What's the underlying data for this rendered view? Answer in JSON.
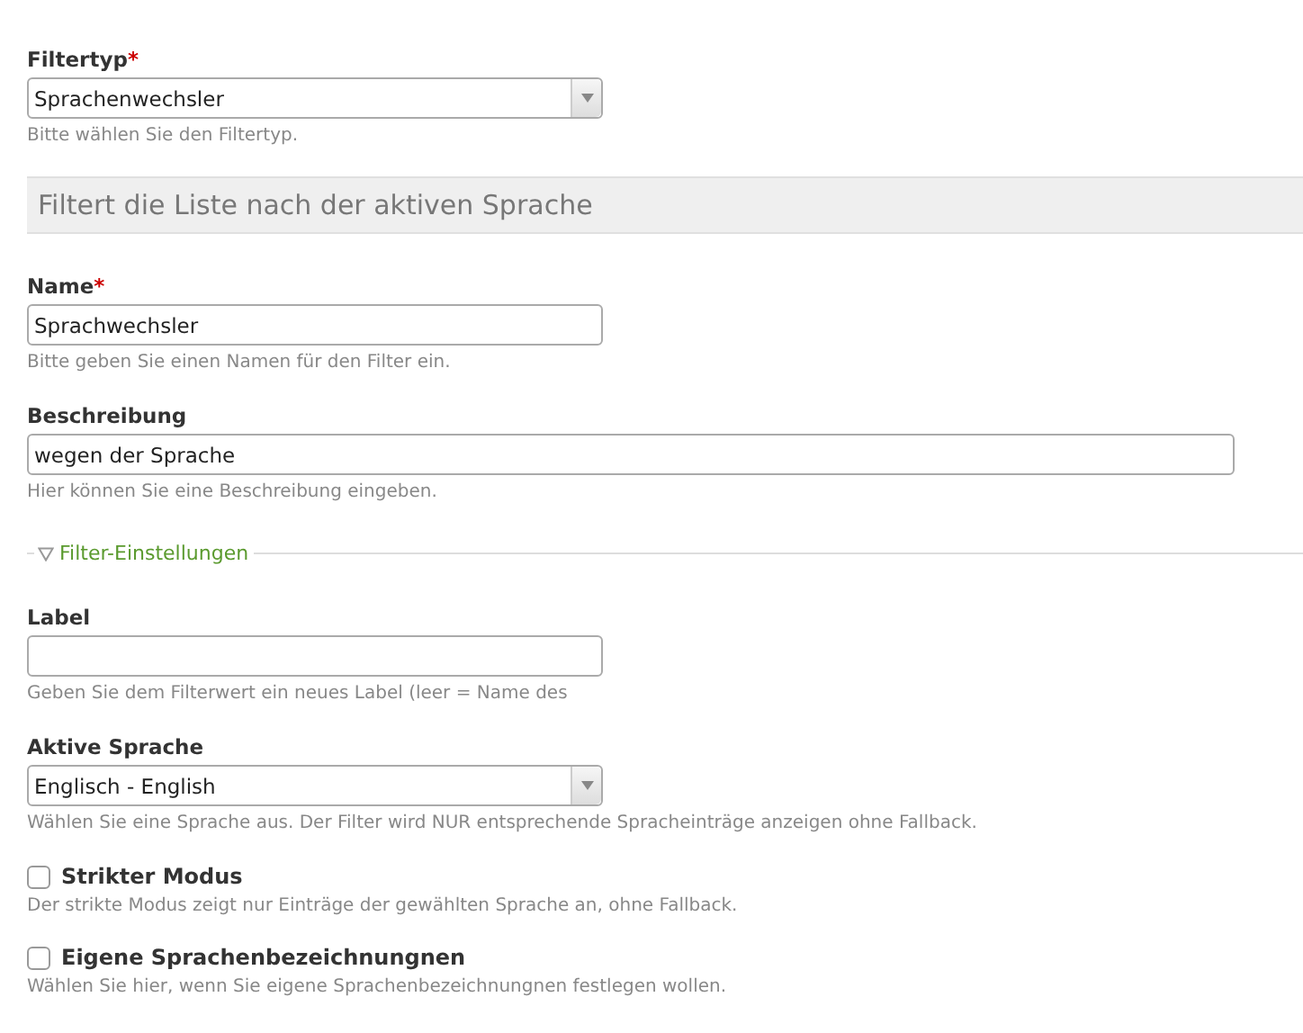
{
  "fields": [
    {
      "kind": "select",
      "label": "Filtertyp",
      "required_mark": "*",
      "value": "Sprachenwechsler",
      "hint": "Bitte wählen Sie den Filtertyp.",
      "wide": false
    },
    {
      "kind": "heading",
      "text": "Filtert die Liste nach der aktiven Sprache"
    },
    {
      "kind": "text",
      "label": "Name",
      "required_mark": "*",
      "value": "Sprachwechsler",
      "hint": "Bitte geben Sie einen Namen für den Filter ein.",
      "wide": false
    },
    {
      "kind": "text",
      "label": "Beschreibung",
      "value": "wegen der Sprache",
      "hint": "Hier können Sie eine Beschreibung eingeben.",
      "wide": true
    },
    {
      "kind": "fieldset",
      "text": "Filter-Einstellungen",
      "expanded": true
    },
    {
      "kind": "text",
      "label": "Label",
      "hint": "Geben Sie dem Filterwert ein neues Label (leer = Name des",
      "wide": false
    },
    {
      "kind": "select",
      "label": "Aktive Sprache",
      "value": "Englisch - English",
      "hint": "Wählen Sie eine Sprache aus. Der Filter wird NUR entsprechende Spracheinträge anzeigen ohne Fallback.",
      "wide": false
    },
    {
      "kind": "checkbox",
      "label": "Strikter Modus",
      "checked": false,
      "hint": "Der strikte Modus zeigt nur Einträge der gewählten Sprache an, ohne Fallback."
    },
    {
      "kind": "checkbox",
      "label": "Eigene Sprachenbezeichnungnen",
      "checked": false,
      "hint": "Wählen Sie hier, wenn Sie eigene Sprachenbezeichnungnen festlegen wollen."
    }
  ]
}
